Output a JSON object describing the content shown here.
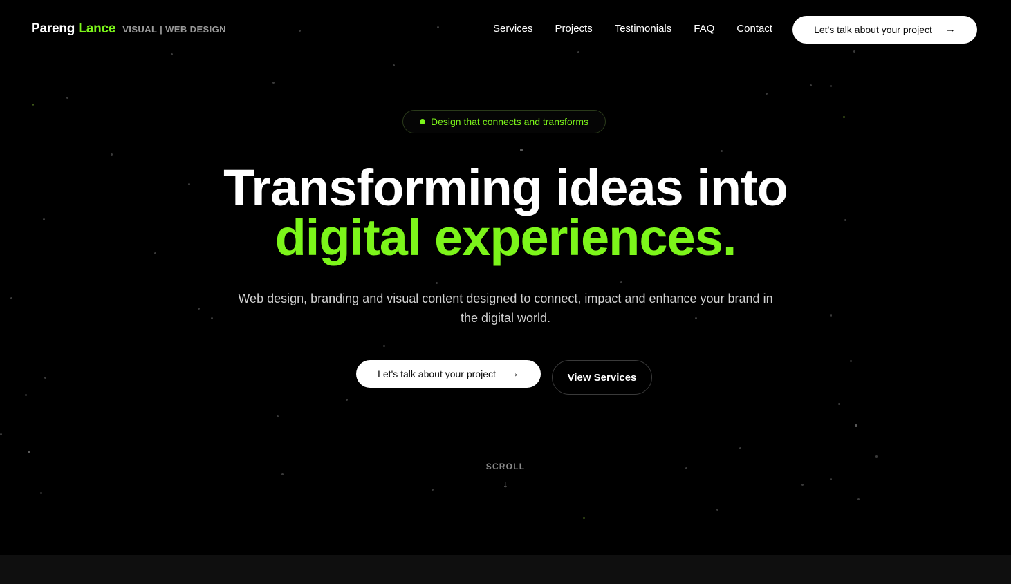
{
  "brand": {
    "first_name": "Pareng",
    "last_name": "Lance",
    "tagline": "VISUAL | WEB DESIGN"
  },
  "nav": {
    "items": [
      "Services",
      "Projects",
      "Testimonials",
      "FAQ",
      "Contact"
    ],
    "cta_label": "Let's talk about your project",
    "cta_icon": "arrow-right-icon"
  },
  "hero": {
    "badge": "Design that connects and transforms",
    "headline_line1": "Transforming ideas into",
    "headline_line2": "digital experiences.",
    "subtitle": "Web design, branding and visual content designed to connect, impact and enhance your brand in the digital world.",
    "primary_cta": "Let's talk about your project",
    "secondary_cta": "View Services",
    "scroll_label": "SCROLL",
    "scroll_icon": "arrow-down-icon"
  },
  "colors": {
    "background": "#000000",
    "accent": "#7cf51a",
    "text": "#ffffff",
    "muted": "#d0d0d0"
  }
}
